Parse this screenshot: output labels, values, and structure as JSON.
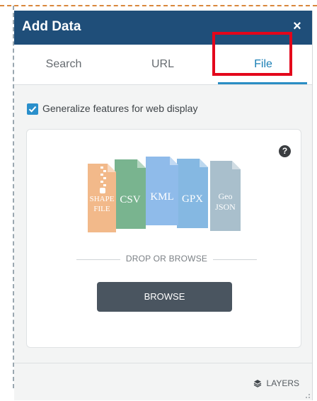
{
  "dialog": {
    "title": "Add Data",
    "close_symbol": "×"
  },
  "tabs": [
    {
      "label": "Search",
      "active": false
    },
    {
      "label": "URL",
      "active": false
    },
    {
      "label": "File",
      "active": true
    }
  ],
  "options": {
    "generalize_label": "Generalize features for web display",
    "generalize_checked": true
  },
  "file_types": [
    {
      "lines": [
        "SHAPE",
        "FILE"
      ],
      "color": "#f2b98a",
      "icon": "zip-shapefile-icon"
    },
    {
      "lines": [
        "CSV"
      ],
      "color": "#79b48f",
      "icon": "csv-file-icon"
    },
    {
      "lines": [
        "KML"
      ],
      "color": "#8fbbea",
      "icon": "kml-file-icon"
    },
    {
      "lines": [
        "GPX"
      ],
      "color": "#85b8e2",
      "icon": "gpx-file-icon"
    },
    {
      "lines": [
        "Geo",
        "JSON"
      ],
      "color": "#a9bfcc",
      "icon": "geojson-file-icon"
    }
  ],
  "dropzone": {
    "drop_text": "DROP OR BROWSE",
    "browse_label": "BROWSE",
    "help_symbol": "?"
  },
  "footer": {
    "layers_label": "LAYERS"
  },
  "colors": {
    "header": "#1f4e79",
    "active_tab": "#1a7fb5",
    "highlight": "#e3061b",
    "browse_button": "#4a5560"
  }
}
